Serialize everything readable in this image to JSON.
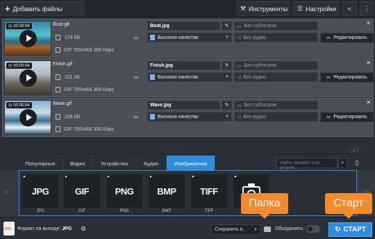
{
  "toolbar": {
    "add_files": "Добавить файлы",
    "tools": "Инструменты",
    "settings": "Настройки"
  },
  "files": [
    {
      "time": "00:00:04",
      "name": "Boat.gif",
      "size": "174 КБ",
      "meta": "GIF 700x466 285 Kbps",
      "output_name": "Boat.jpg",
      "quality": "Высокое качество",
      "subtitles": "Без субтитров",
      "audio": "Без аудио",
      "edit": "Редактировать"
    },
    {
      "time": "00:00:04",
      "name": "Finish.gif",
      "size": "101 КБ",
      "meta": "GIF 700x468 365 Kbps",
      "output_name": "Finish.jpg",
      "quality": "Высокое качество",
      "subtitles": "Без субтитров",
      "audio": "Без аудио",
      "edit": "Редактировать"
    },
    {
      "time": "00:00:04",
      "name": "Wave.gif",
      "size": "205 КБ",
      "meta": "GIF 700x466 336 Kbps",
      "output_name": "Wave.jpg",
      "quality": "Высокое качество",
      "subtitles": "Без субтитров",
      "audio": "Без аудио",
      "edit": "Редактировать"
    }
  ],
  "tabs": {
    "popular": "Популярные",
    "video": "Видео",
    "devices": "Устройства",
    "audio": "Аудио",
    "images": "Изображения",
    "active": "images"
  },
  "search": {
    "placeholder": "Найти формат или устрой..."
  },
  "formats": [
    {
      "logo": "JPG",
      "label": "JPG"
    },
    {
      "logo": "GIF",
      "label": "GIF"
    },
    {
      "logo": "PNG",
      "label": "PNG"
    },
    {
      "logo": "BMP",
      "label": "BMP"
    },
    {
      "logo": "TIFF",
      "label": "TIFF"
    },
    {
      "logo": "",
      "label": ""
    }
  ],
  "bottom": {
    "output_format_label": "Формат на выходе:",
    "output_format_value": "JPG",
    "save_to": "Сохранить в...",
    "merge": "Объединить:",
    "start": "СТАРТ"
  },
  "callouts": {
    "folder": "Папка",
    "start": "Старт"
  },
  "colors": {
    "accent": "#2d8ee0",
    "callout": "#f28a2e"
  }
}
